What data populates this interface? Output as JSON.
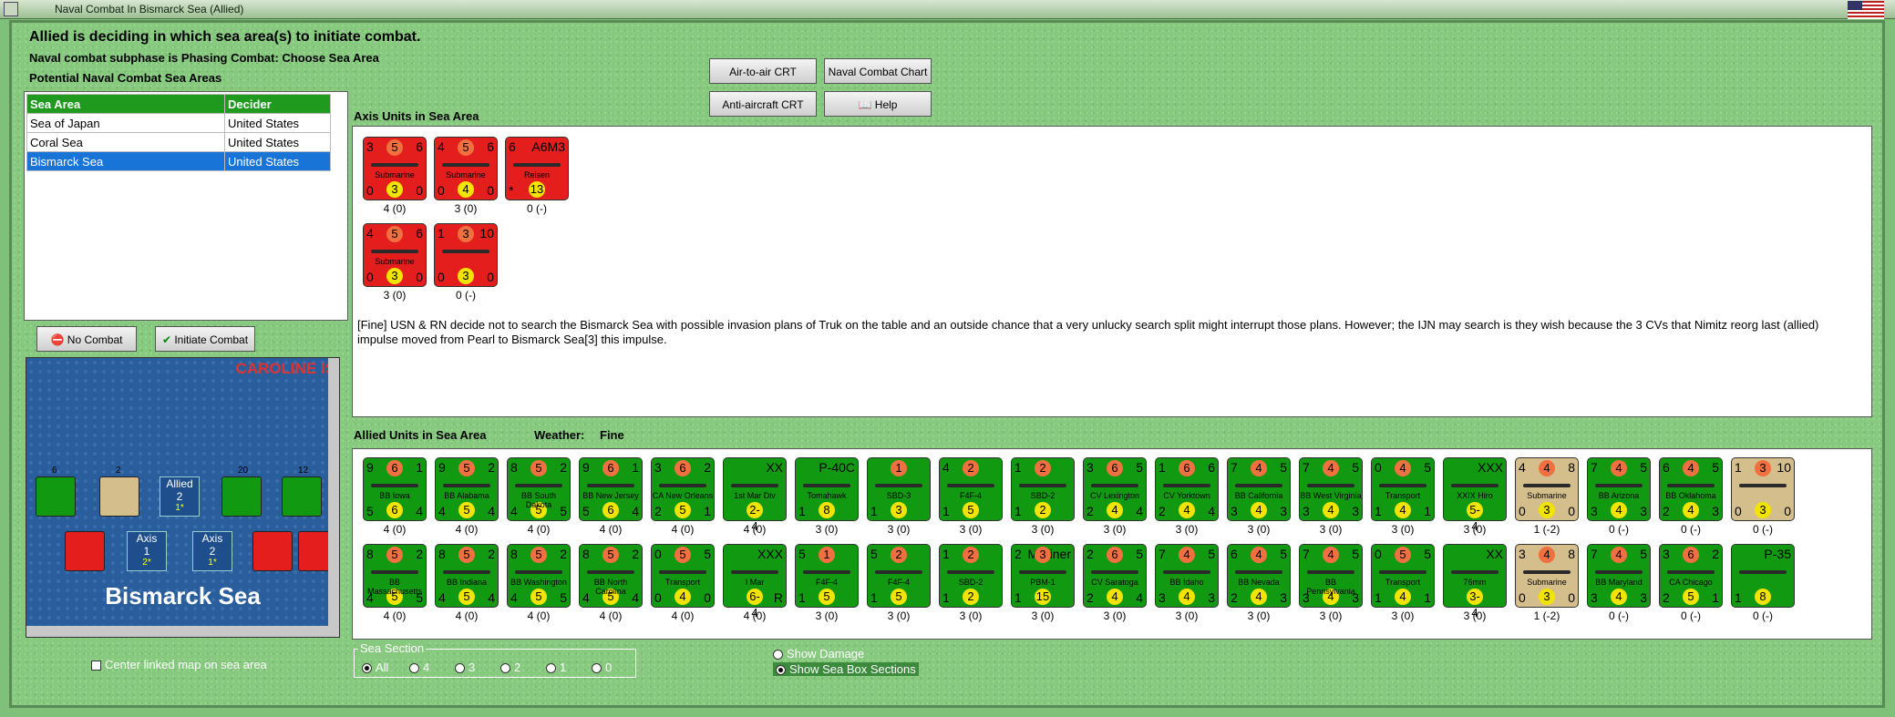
{
  "window": {
    "title": "Naval Combat In Bismarck Sea (Allied)"
  },
  "header": {
    "line1": "Allied is deciding in which sea area(s) to initiate combat.",
    "line2": "Naval combat subphase is Phasing Combat: Choose Sea Area",
    "line3": "Potential Naval Combat Sea Areas"
  },
  "sea_table": {
    "headers": [
      "Sea Area",
      "Decider"
    ],
    "rows": [
      [
        "Sea of Japan",
        "United States"
      ],
      [
        "Coral Sea",
        "United States"
      ],
      [
        "Bismarck Sea",
        "United States"
      ]
    ],
    "selected_index": 2
  },
  "buttons": {
    "air_to_air": "Air-to-air CRT",
    "naval_chart": "Naval Combat Chart",
    "anti_aircraft": "Anti-aircraft CRT",
    "help": "Help",
    "no_combat": "No Combat",
    "initiate_combat": "Initiate Combat"
  },
  "axis": {
    "label": "Axis Units in Sea Area",
    "units": [
      {
        "tl": "3",
        "tc": "5",
        "tr": "6",
        "name": "Submarine",
        "bl": "0",
        "bc": "3",
        "br": "0",
        "caption": "4 (0)",
        "color": "red"
      },
      {
        "tl": "4",
        "tc": "5",
        "tr": "6",
        "name": "Submarine",
        "bl": "0",
        "bc": "4",
        "br": "0",
        "caption": "3 (0)",
        "color": "red"
      },
      {
        "tl": "6",
        "tc": "",
        "tr": "A6M3",
        "name": "Reisen",
        "bl": "*",
        "bc": "13",
        "br": "",
        "caption": "0 (-)",
        "color": "red"
      },
      {
        "tl": "4",
        "tc": "5",
        "tr": "6",
        "name": "Submarine",
        "bl": "0",
        "bc": "3",
        "br": "0",
        "caption": "3 (0)",
        "color": "red"
      },
      {
        "tl": "1",
        "tc": "3",
        "tr": "10",
        "name": "",
        "bl": "0",
        "bc": "3",
        "br": "0",
        "caption": "0 (-)",
        "color": "red"
      }
    ]
  },
  "note": "[Fine] USN & RN decide not to search the Bismarck Sea with possible invasion plans of Truk on the table and an outside chance that a very unlucky search split might interrupt those plans.  However; the IJN may search is they wish because the 3 CVs that Nimitz reorg last (allied) impulse moved from Pearl to Bismarck Sea[3] this impulse.",
  "allied": {
    "label": "Allied Units in Sea Area",
    "weather_label": "Weather:",
    "weather": "Fine",
    "row1": [
      {
        "tl": "9",
        "tc": "6",
        "tr": "1",
        "name": "BB Iowa",
        "bl": "5",
        "bc": "6",
        "br": "4",
        "caption": "4 (0)",
        "color": "green"
      },
      {
        "tl": "9",
        "tc": "5",
        "tr": "2",
        "name": "BB Alabama",
        "bl": "4",
        "bc": "5",
        "br": "4",
        "caption": "4 (0)",
        "color": "green"
      },
      {
        "tl": "8",
        "tc": "5",
        "tr": "2",
        "name": "BB South Dakota",
        "bl": "4",
        "bc": "5",
        "br": "5",
        "caption": "4 (0)",
        "color": "green"
      },
      {
        "tl": "9",
        "tc": "6",
        "tr": "1",
        "name": "BB New Jersey",
        "bl": "5",
        "bc": "6",
        "br": "4",
        "caption": "4 (0)",
        "color": "green"
      },
      {
        "tl": "3",
        "tc": "6",
        "tr": "2",
        "name": "CA New Orleans",
        "bl": "2",
        "bc": "5",
        "br": "1",
        "caption": "4 (0)",
        "color": "green"
      },
      {
        "tl": "",
        "tc": "",
        "tr": "XX",
        "name": "1st Mar Div",
        "bl": "",
        "bc": "2-4",
        "br": "",
        "caption": "4 (0)",
        "color": "green"
      },
      {
        "tl": "",
        "tc": "",
        "tr": "P-40C",
        "name": "Tomahawk",
        "bl": "1",
        "bc": "8",
        "br": "",
        "caption": "3 (0)",
        "color": "green"
      },
      {
        "tl": "",
        "tc": "1",
        "tr": "",
        "name": "SBD-3",
        "bl": "1",
        "bc": "3",
        "br": "",
        "caption": "3 (0)",
        "color": "green"
      },
      {
        "tl": "4",
        "tc": "2",
        "tr": "",
        "name": "F4F-4",
        "bl": "1",
        "bc": "5",
        "br": "",
        "caption": "3 (0)",
        "color": "green"
      },
      {
        "tl": "1",
        "tc": "2",
        "tr": "",
        "name": "SBD-2",
        "bl": "1",
        "bc": "2",
        "br": "",
        "caption": "3 (0)",
        "color": "green"
      },
      {
        "tl": "3",
        "tc": "6",
        "tr": "5",
        "name": "CV Lexington",
        "bl": "2",
        "bc": "4",
        "br": "4",
        "caption": "3 (0)",
        "color": "green"
      },
      {
        "tl": "1",
        "tc": "6",
        "tr": "6",
        "name": "CV Yorktown",
        "bl": "2",
        "bc": "4",
        "br": "4",
        "caption": "3 (0)",
        "color": "green"
      },
      {
        "tl": "7",
        "tc": "4",
        "tr": "5",
        "name": "BB California",
        "bl": "3",
        "bc": "4",
        "br": "3",
        "caption": "3 (0)",
        "color": "green"
      },
      {
        "tl": "7",
        "tc": "4",
        "tr": "5",
        "name": "BB West Virginia",
        "bl": "3",
        "bc": "4",
        "br": "3",
        "caption": "3 (0)",
        "color": "green"
      },
      {
        "tl": "0",
        "tc": "4",
        "tr": "5",
        "name": "Transport",
        "bl": "1",
        "bc": "4",
        "br": "1",
        "caption": "3 (0)",
        "color": "green"
      },
      {
        "tl": "",
        "tc": "",
        "tr": "XXX",
        "name": "XXIX Hiro",
        "bl": "",
        "bc": "5-4",
        "br": "",
        "caption": "3 (0)",
        "color": "green"
      },
      {
        "tl": "4",
        "tc": "4",
        "tr": "8",
        "name": "Submarine",
        "bl": "0",
        "bc": "3",
        "br": "0",
        "caption": "1 (-2)",
        "color": "tan"
      },
      {
        "tl": "7",
        "tc": "4",
        "tr": "5",
        "name": "BB Arizona",
        "bl": "3",
        "bc": "4",
        "br": "3",
        "caption": "0 (-)",
        "color": "green"
      },
      {
        "tl": "6",
        "tc": "4",
        "tr": "5",
        "name": "BB Oklahoma",
        "bl": "2",
        "bc": "4",
        "br": "3",
        "caption": "0 (-)",
        "color": "green"
      },
      {
        "tl": "1",
        "tc": "3",
        "tr": "10",
        "name": "",
        "bl": "0",
        "bc": "3",
        "br": "0",
        "caption": "0 (-)",
        "color": "tan"
      }
    ],
    "row2": [
      {
        "tl": "8",
        "tc": "5",
        "tr": "2",
        "name": "BB Massachusetts",
        "bl": "4",
        "bc": "5",
        "br": "5",
        "caption": "4 (0)",
        "color": "green"
      },
      {
        "tl": "8",
        "tc": "5",
        "tr": "2",
        "name": "BB Indiana",
        "bl": "4",
        "bc": "5",
        "br": "4",
        "caption": "4 (0)",
        "color": "green"
      },
      {
        "tl": "8",
        "tc": "5",
        "tr": "2",
        "name": "BB Washington",
        "bl": "4",
        "bc": "5",
        "br": "5",
        "caption": "4 (0)",
        "color": "green"
      },
      {
        "tl": "8",
        "tc": "5",
        "tr": "2",
        "name": "BB North Carolina",
        "bl": "4",
        "bc": "5",
        "br": "4",
        "caption": "4 (0)",
        "color": "green"
      },
      {
        "tl": "0",
        "tc": "5",
        "tr": "5",
        "name": "Transport",
        "bl": "0",
        "bc": "4",
        "br": "0",
        "caption": "4 (0)",
        "color": "green"
      },
      {
        "tl": "",
        "tc": "",
        "tr": "XXX",
        "name": "I Mar",
        "bl": "",
        "bc": "6-4",
        "br": "R",
        "caption": "4 (0)",
        "color": "green"
      },
      {
        "tl": "5",
        "tc": "1",
        "tr": "",
        "name": "F4F-4",
        "bl": "1",
        "bc": "5",
        "br": "",
        "caption": "3 (0)",
        "color": "green"
      },
      {
        "tl": "5",
        "tc": "2",
        "tr": "",
        "name": "F4F-4",
        "bl": "1",
        "bc": "5",
        "br": "",
        "caption": "3 (0)",
        "color": "green"
      },
      {
        "tl": "1",
        "tc": "2",
        "tr": "",
        "name": "SBD-2",
        "bl": "1",
        "bc": "2",
        "br": "",
        "caption": "3 (0)",
        "color": "green"
      },
      {
        "tl": "2",
        "tc": "3",
        "tr": "Mariner",
        "name": "PBM-1",
        "bl": "1",
        "bc": "15",
        "br": "",
        "caption": "3 (0)",
        "color": "green"
      },
      {
        "tl": "2",
        "tc": "6",
        "tr": "5",
        "name": "CV Saratoga",
        "bl": "2",
        "bc": "4",
        "br": "4",
        "caption": "3 (0)",
        "color": "green"
      },
      {
        "tl": "7",
        "tc": "4",
        "tr": "5",
        "name": "BB Idaho",
        "bl": "3",
        "bc": "4",
        "br": "3",
        "caption": "3 (0)",
        "color": "green"
      },
      {
        "tl": "6",
        "tc": "4",
        "tr": "5",
        "name": "BB Nevada",
        "bl": "2",
        "bc": "4",
        "br": "3",
        "caption": "3 (0)",
        "color": "green"
      },
      {
        "tl": "7",
        "tc": "4",
        "tr": "5",
        "name": "BB Pennsylvania",
        "bl": "3",
        "bc": "4",
        "br": "3",
        "caption": "3 (0)",
        "color": "green"
      },
      {
        "tl": "0",
        "tc": "5",
        "tr": "5",
        "name": "Transport",
        "bl": "1",
        "bc": "4",
        "br": "1",
        "caption": "3 (0)",
        "color": "green"
      },
      {
        "tl": "",
        "tc": "",
        "tr": "XX",
        "name": "76mm",
        "bl": "",
        "bc": "3-4",
        "br": "",
        "caption": "3 (0)",
        "color": "green"
      },
      {
        "tl": "3",
        "tc": "4",
        "tr": "8",
        "name": "Submarine",
        "bl": "0",
        "bc": "3",
        "br": "0",
        "caption": "1 (-2)",
        "color": "tan"
      },
      {
        "tl": "7",
        "tc": "4",
        "tr": "5",
        "name": "BB Maryland",
        "bl": "3",
        "bc": "4",
        "br": "3",
        "caption": "0 (-)",
        "color": "green"
      },
      {
        "tl": "3",
        "tc": "6",
        "tr": "2",
        "name": "CA Chicago",
        "bl": "2",
        "bc": "5",
        "br": "1",
        "caption": "0 (-)",
        "color": "green"
      },
      {
        "tl": "",
        "tc": "",
        "tr": "P-35",
        "name": "",
        "bl": "1",
        "bc": "8",
        "br": "",
        "caption": "0 (-)",
        "color": "green"
      }
    ]
  },
  "map": {
    "title": "CAROLINE IS",
    "sea_label": "Bismarck Sea",
    "allied_box": {
      "label": "Allied",
      "value": "2",
      "sub": "1*"
    },
    "axis_box1": {
      "label": "Axis",
      "value": "1",
      "sub": "2*"
    },
    "axis_box2": {
      "label": "Axis",
      "value": "2",
      "sub": "1*"
    },
    "stack_counts": [
      "6",
      "2",
      "20",
      "12"
    ]
  },
  "center_link": "Center linked map on sea area",
  "sea_section": {
    "label": "Sea Section",
    "options": [
      "All",
      "4",
      "3",
      "2",
      "1",
      "0"
    ],
    "selected": "All"
  },
  "options": {
    "show_damage": "Show Damage",
    "show_sea_box": "Show Sea Box Sections"
  },
  "colors": {
    "red": "#e41d1d",
    "green": "#119a11",
    "tan": "#d4bf8c",
    "selected": "#1874d6"
  }
}
